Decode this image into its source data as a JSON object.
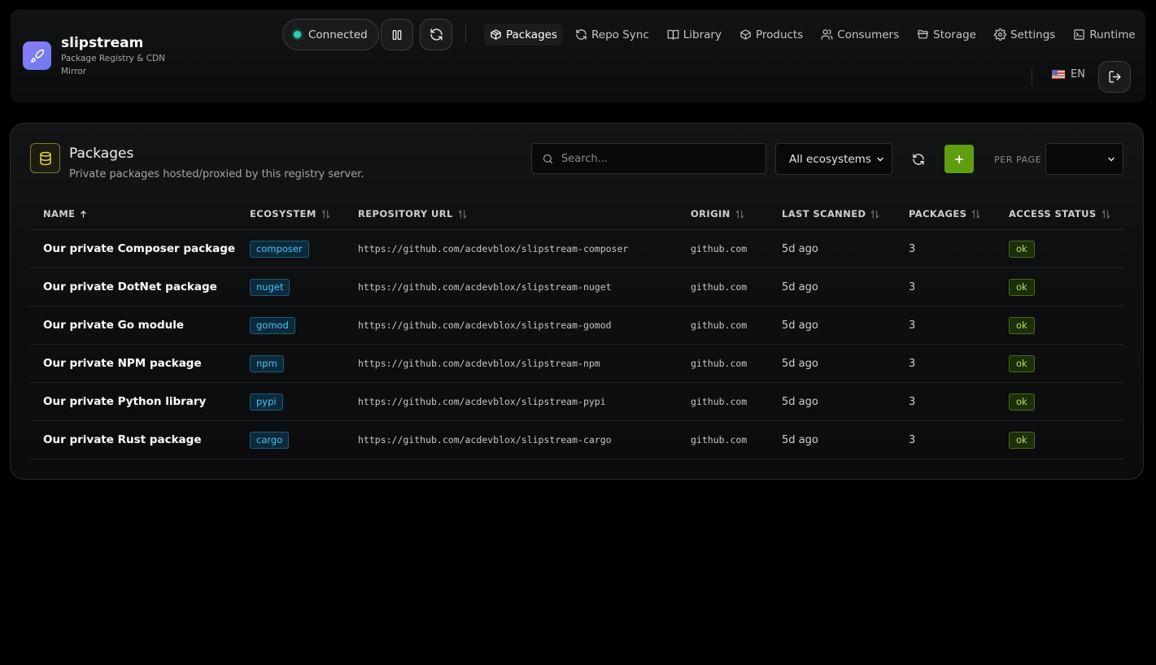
{
  "brand": {
    "name": "slipstream",
    "subtitle": "Package Registry & CDN Mirror"
  },
  "status": {
    "label": "Connected",
    "color": "#2fd0b0"
  },
  "nav": [
    {
      "label": "Packages",
      "icon": "package-icon",
      "active": true
    },
    {
      "label": "Repo Sync",
      "icon": "refresh-icon",
      "active": false
    },
    {
      "label": "Library",
      "icon": "book-icon",
      "active": false
    },
    {
      "label": "Products",
      "icon": "box-icon",
      "active": false
    },
    {
      "label": "Consumers",
      "icon": "users-icon",
      "active": false
    },
    {
      "label": "Storage",
      "icon": "folder-icon",
      "active": false
    },
    {
      "label": "Settings",
      "icon": "gear-icon",
      "active": false
    },
    {
      "label": "Runtime",
      "icon": "terminal-icon",
      "active": false
    }
  ],
  "language": {
    "code": "EN",
    "flag": "us-flag-icon"
  },
  "panel": {
    "title": "Packages",
    "subtitle": "Private packages hosted/proxied by this registry server.",
    "search_placeholder": "Search...",
    "ecosystem_filter": "All ecosystems",
    "per_page_label": "PER PAGE",
    "per_page_value": ""
  },
  "table": {
    "columns": [
      {
        "label": "NAME",
        "sort": "asc"
      },
      {
        "label": "ECOSYSTEM",
        "sort": "none"
      },
      {
        "label": "REPOSITORY URL",
        "sort": "none"
      },
      {
        "label": "ORIGIN",
        "sort": "none"
      },
      {
        "label": "LAST SCANNED",
        "sort": "none"
      },
      {
        "label": "PACKAGES",
        "sort": "none"
      },
      {
        "label": "ACCESS STATUS",
        "sort": "none"
      }
    ],
    "rows": [
      {
        "name": "Our private Composer package",
        "ecosystem": "composer",
        "url": "https://github.com/acdevblox/slipstream-composer",
        "origin": "github.com",
        "last_scanned": "5d ago",
        "packages": "3",
        "status": "ok"
      },
      {
        "name": "Our private DotNet package",
        "ecosystem": "nuget",
        "url": "https://github.com/acdevblox/slipstream-nuget",
        "origin": "github.com",
        "last_scanned": "5d ago",
        "packages": "3",
        "status": "ok"
      },
      {
        "name": "Our private Go module",
        "ecosystem": "gomod",
        "url": "https://github.com/acdevblox/slipstream-gomod",
        "origin": "github.com",
        "last_scanned": "5d ago",
        "packages": "3",
        "status": "ok"
      },
      {
        "name": "Our private NPM package",
        "ecosystem": "npm",
        "url": "https://github.com/acdevblox/slipstream-npm",
        "origin": "github.com",
        "last_scanned": "5d ago",
        "packages": "3",
        "status": "ok"
      },
      {
        "name": "Our private Python library",
        "ecosystem": "pypi",
        "url": "https://github.com/acdevblox/slipstream-pypi",
        "origin": "github.com",
        "last_scanned": "5d ago",
        "packages": "3",
        "status": "ok"
      },
      {
        "name": "Our private Rust package",
        "ecosystem": "cargo",
        "url": "https://github.com/acdevblox/slipstream-cargo",
        "origin": "github.com",
        "last_scanned": "5d ago",
        "packages": "3",
        "status": "ok"
      }
    ]
  },
  "colors": {
    "accent": "#5f9e10",
    "badge_blue": "#4ec0f0",
    "badge_ok": "#b8e060",
    "logo": "#8b7bf6"
  }
}
